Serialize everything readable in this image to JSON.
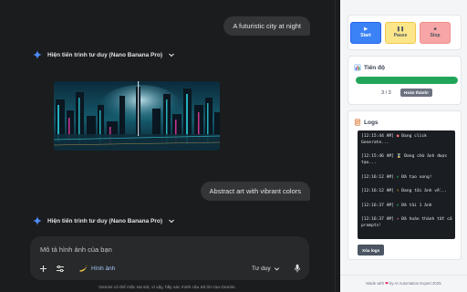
{
  "chat": {
    "messages": [
      {
        "text": "A futuristic city at night"
      },
      {
        "text": "Abstract art with vibrant colors"
      }
    ],
    "thinking_label": "Hiện tiến trình tư duy (Nano Banana Pro)",
    "composer": {
      "placeholder": "Mô tả hình ảnh của bạn",
      "image_chip_label": "Hình ảnh",
      "mode_label": "Tư duy",
      "image_chip_icon": "banana-icon"
    },
    "disclaimer": "Gemini có thể mắc sai sót, vì vậy, hãy xác minh câu trả lời của Gemini.",
    "colors": {
      "background": "#1b1c1d",
      "bubble": "#333537",
      "composer": "#27292a",
      "sparkle": "#4c8df6",
      "chip_text": "#a8c7fa"
    }
  },
  "panel": {
    "controls": {
      "start": {
        "label": "Start",
        "icon": "play-icon",
        "color": "#3b82f6"
      },
      "pause": {
        "label": "Pause",
        "icon": "pause-icon",
        "color": "#fde68a"
      },
      "stop": {
        "label": "Stop",
        "icon": "stop-icon",
        "color": "#f8a5a5"
      }
    },
    "progress": {
      "title": "Tiến độ",
      "icon": "bar-chart-icon",
      "current": 3,
      "total": 3,
      "count_text": "3 / 3",
      "fraction": 1.0,
      "status": "Hoàn thành!",
      "bar_color": "#22a55a"
    },
    "logs": {
      "title": "Logs",
      "icon": "scroll-icon",
      "entries": [
        {
          "time": "[12:15:44 AM]",
          "icon": "circle-icon",
          "text": "Đang click Generate..."
        },
        {
          "time": "[12:15:46 AM]",
          "icon": "hourglass-icon",
          "text": "Đang chờ ảnh được tạo..."
        },
        {
          "time": "[12:16:12 AM]",
          "icon": "check-icon",
          "text": "Đã tạo xong!"
        },
        {
          "time": "[12:16:12 AM]",
          "icon": "download-icon",
          "text": "Đang tải ảnh về..."
        },
        {
          "time": "[12:16:37 AM]",
          "icon": "check-icon",
          "text": "Đã tải 1 ảnh"
        },
        {
          "time": "[12:16:37 AM]",
          "icon": "party-icon",
          "text": "Đã hoàn thành tất cả prompts!"
        }
      ],
      "clear_label": "Xóa logs"
    },
    "footer": {
      "prefix": "Made with",
      "suffix": "by AI Automation Expert 2025"
    }
  }
}
